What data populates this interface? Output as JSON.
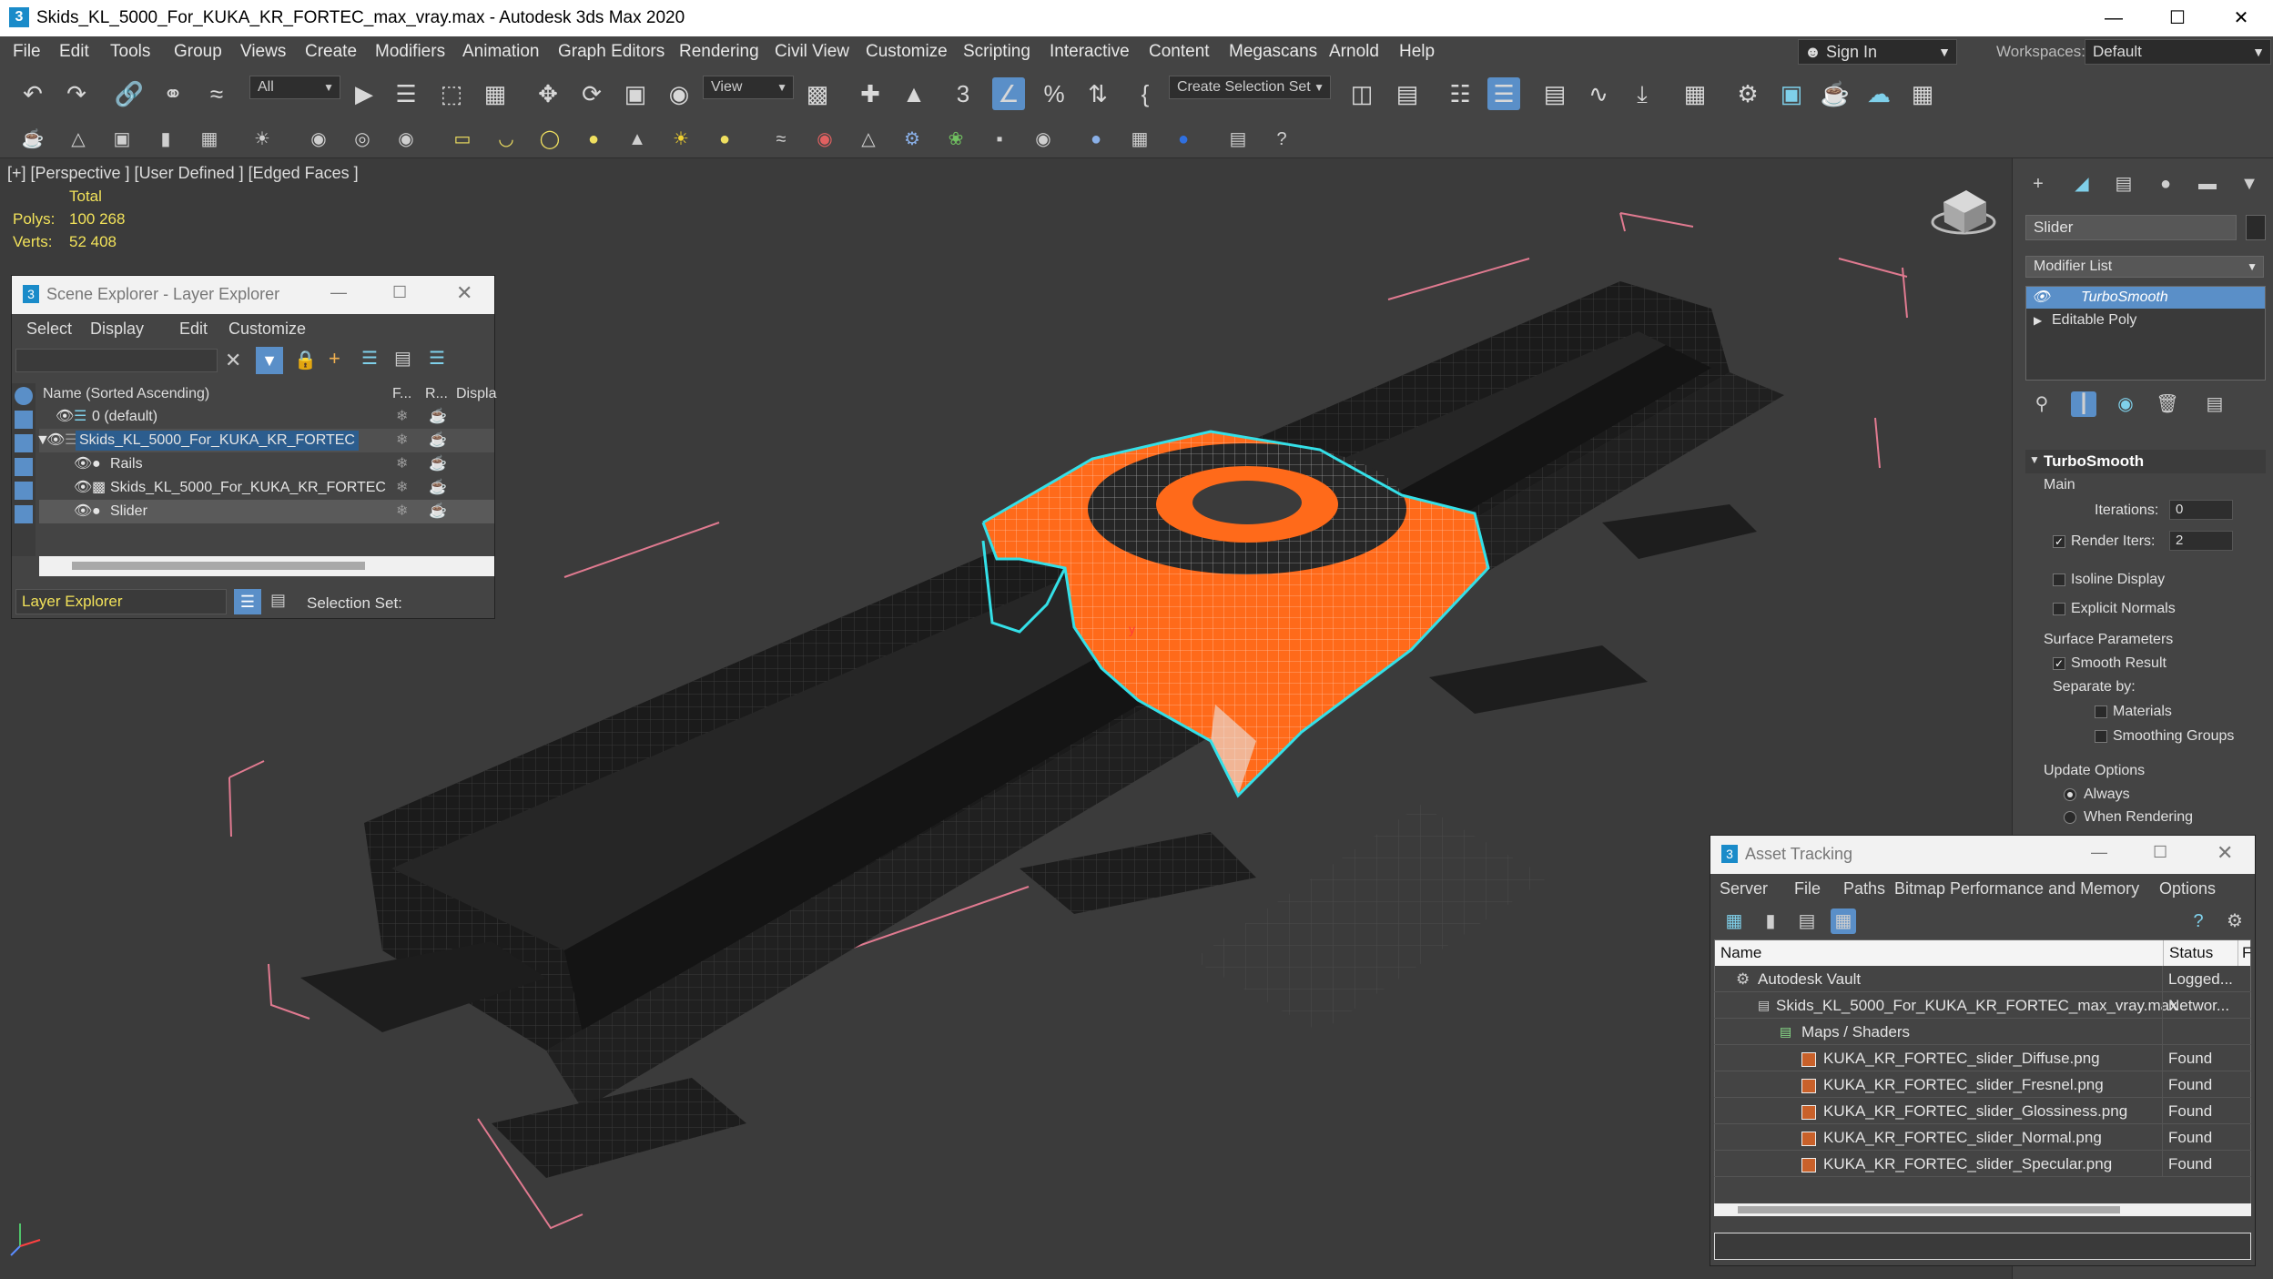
{
  "window": {
    "title": "Skids_KL_5000_For_KUKA_KR_FORTEC_max_vray.max - Autodesk 3ds Max 2020",
    "app_icon": "3"
  },
  "menu": [
    "File",
    "Edit",
    "Tools",
    "Group",
    "Views",
    "Create",
    "Modifiers",
    "Animation",
    "Graph Editors",
    "Rendering",
    "Civil View",
    "Customize",
    "Scripting",
    "Interactive",
    "Content",
    "Megascans",
    "Arnold",
    "Help"
  ],
  "account": {
    "sign_in": "Sign In",
    "workspaces_label": "Workspaces:",
    "workspace": "Default"
  },
  "toolbar": {
    "filter": "All",
    "ref_coord": "View",
    "selection_set": "Create Selection Set"
  },
  "viewport": {
    "label": "[+] [Perspective ] [User Defined ] [Edged Faces ]",
    "stats_header": "Total",
    "polys_label": "Polys:",
    "polys_value": "100 268",
    "verts_label": "Verts:",
    "verts_value": "52 408"
  },
  "scene_explorer": {
    "title": "Scene Explorer - Layer Explorer",
    "menu": [
      "Select",
      "Display",
      "Edit",
      "Customize"
    ],
    "col_name": "Name (Sorted Ascending)",
    "col_f": "F...",
    "col_r": "R...",
    "col_display": "Displa",
    "rows": [
      {
        "label": "0 (default)"
      },
      {
        "label": "Skids_KL_5000_For_KUKA_KR_FORTEC"
      },
      {
        "label": "Rails"
      },
      {
        "label": "Skids_KL_5000_For_KUKA_KR_FORTEC"
      },
      {
        "label": "Slider"
      }
    ],
    "footer_explorer": "Layer Explorer",
    "footer_selection": "Selection Set:"
  },
  "command_panel": {
    "object_name": "Slider",
    "modifier_list": "Modifier List",
    "stack": [
      "TurboSmooth",
      "Editable Poly"
    ],
    "rollout_title": "TurboSmooth",
    "main_label": "Main",
    "iterations_label": "Iterations:",
    "iterations_value": "0",
    "render_iters_label": "Render Iters:",
    "render_iters_value": "2",
    "isoline": "Isoline Display",
    "explicit_normals": "Explicit Normals",
    "surface_params": "Surface Parameters",
    "smooth_result": "Smooth Result",
    "separate_by": "Separate by:",
    "materials": "Materials",
    "smoothing_groups": "Smoothing Groups",
    "update_options": "Update Options",
    "always": "Always",
    "when_rendering": "When Rendering"
  },
  "asset_tracking": {
    "title": "Asset Tracking",
    "menu": [
      "Server",
      "File",
      "Paths",
      "Bitmap Performance and Memory",
      "Options"
    ],
    "col_name": "Name",
    "col_status": "Status",
    "col_extra": "F",
    "rows": [
      {
        "name": "Autodesk Vault",
        "status": "Logged..."
      },
      {
        "name": "Skids_KL_5000_For_KUKA_KR_FORTEC_max_vray.max",
        "status": "Networ..."
      },
      {
        "name": "Maps / Shaders",
        "status": ""
      },
      {
        "name": "KUKA_KR_FORTEC_slider_Diffuse.png",
        "status": "Found"
      },
      {
        "name": "KUKA_KR_FORTEC_slider_Fresnel.png",
        "status": "Found"
      },
      {
        "name": "KUKA_KR_FORTEC_slider_Glossiness.png",
        "status": "Found"
      },
      {
        "name": "KUKA_KR_FORTEC_slider_Normal.png",
        "status": "Found"
      },
      {
        "name": "KUKA_KR_FORTEC_slider_Specular.png",
        "status": "Found"
      }
    ]
  },
  "colors": {
    "accent": "#2e8bd8",
    "selection": "#ff6a1a",
    "outline": "#34e0e8",
    "stats": "#f2e25a"
  }
}
